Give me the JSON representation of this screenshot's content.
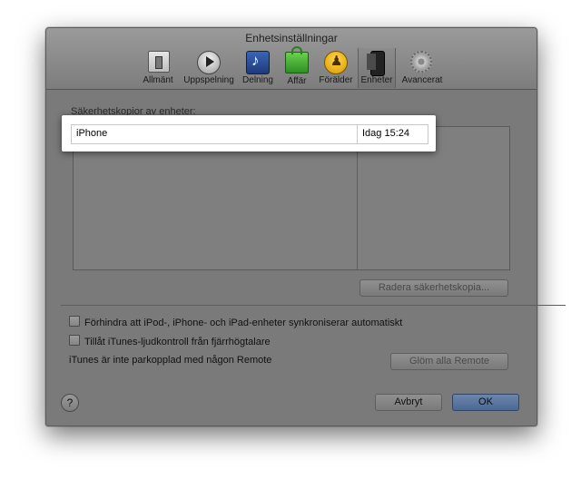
{
  "window": {
    "title": "Enhetsinställningar"
  },
  "toolbar": {
    "items": [
      {
        "label": "Allmänt",
        "icon": "general-switch-icon",
        "selected": false
      },
      {
        "label": "Uppspelning",
        "icon": "play-icon",
        "selected": false
      },
      {
        "label": "Delning",
        "icon": "sharing-music-icon",
        "selected": false
      },
      {
        "label": "Affär",
        "icon": "store-bag-icon",
        "selected": false
      },
      {
        "label": "Förälder",
        "icon": "parental-icon",
        "selected": false
      },
      {
        "label": "Enheter",
        "icon": "devices-iphone-icon",
        "selected": true
      },
      {
        "label": "Avancerat",
        "icon": "advanced-gear-icon",
        "selected": false
      }
    ]
  },
  "backups": {
    "section_label": "Säkerhetskopior av enheter:",
    "rows": [
      {
        "name": "iPhone",
        "date": "Idag 15:24"
      }
    ],
    "delete_button": "Radera säkerhetskopia..."
  },
  "options": {
    "prevent_sync_label": "Förhindra att iPod-, iPhone- och iPad-enheter synkroniserar automatiskt",
    "prevent_sync_checked": false,
    "allow_remote_audio_label": "Tillåt iTunes-ljudkontroll från fjärrhögtalare",
    "allow_remote_audio_checked": false,
    "remote_status": "iTunes är inte parkopplad med någon Remote",
    "forget_remotes_button": "Glöm alla Remote"
  },
  "footer": {
    "help": "?",
    "cancel": "Avbryt",
    "ok": "OK"
  },
  "colors": {
    "window_bg": "#7a7a7a",
    "highlight_bg": "#ffffff",
    "primary_button": "#5a76a0"
  }
}
